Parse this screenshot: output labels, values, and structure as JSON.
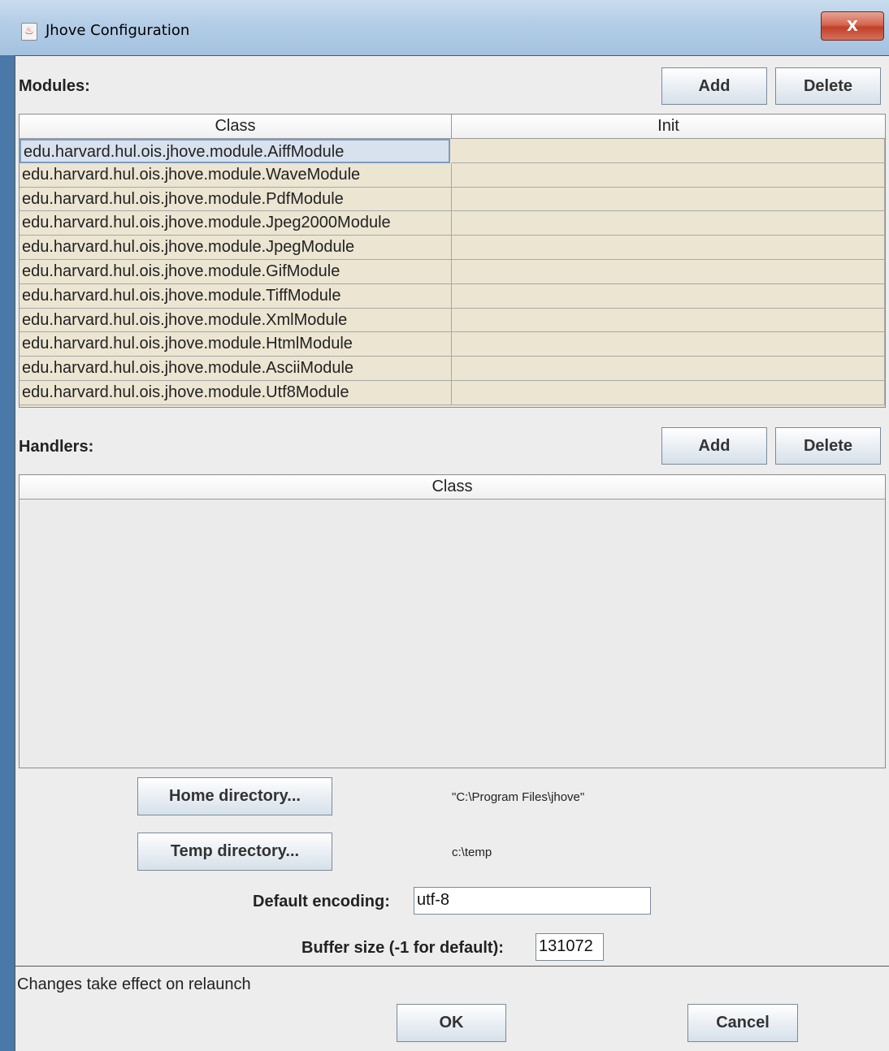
{
  "window": {
    "title": "Jhove Configuration",
    "close_label": "X"
  },
  "modules": {
    "label": "Modules:",
    "add_label": "Add",
    "delete_label": "Delete",
    "columns": [
      "Class",
      "Init"
    ],
    "rows": [
      {
        "class": "edu.harvard.hul.ois.jhove.module.AiffModule",
        "init": ""
      },
      {
        "class": "edu.harvard.hul.ois.jhove.module.WaveModule",
        "init": ""
      },
      {
        "class": "edu.harvard.hul.ois.jhove.module.PdfModule",
        "init": ""
      },
      {
        "class": "edu.harvard.hul.ois.jhove.module.Jpeg2000Module",
        "init": ""
      },
      {
        "class": "edu.harvard.hul.ois.jhove.module.JpegModule",
        "init": ""
      },
      {
        "class": "edu.harvard.hul.ois.jhove.module.GifModule",
        "init": ""
      },
      {
        "class": "edu.harvard.hul.ois.jhove.module.TiffModule",
        "init": ""
      },
      {
        "class": "edu.harvard.hul.ois.jhove.module.XmlModule",
        "init": ""
      },
      {
        "class": "edu.harvard.hul.ois.jhove.module.HtmlModule",
        "init": ""
      },
      {
        "class": "edu.harvard.hul.ois.jhove.module.AsciiModule",
        "init": ""
      },
      {
        "class": "edu.harvard.hul.ois.jhove.module.Utf8Module",
        "init": ""
      }
    ]
  },
  "handlers": {
    "label": "Handlers:",
    "add_label": "Add",
    "delete_label": "Delete",
    "columns": [
      "Class"
    ]
  },
  "directories": {
    "home_button": "Home directory...",
    "home_path": "\"C:\\Program Files\\jhove\"",
    "temp_button": "Temp directory...",
    "temp_path": "c:\\temp"
  },
  "settings": {
    "encoding_label": "Default encoding:",
    "encoding_value": "utf-8",
    "buffer_label": "Buffer size (-1 for default):",
    "buffer_value": "131072"
  },
  "footer": {
    "status": "Changes take effect on relaunch",
    "ok_label": "OK",
    "cancel_label": "Cancel"
  },
  "icons": {
    "app_icon": "java-coffee-icon",
    "close_icon": "close-icon"
  }
}
